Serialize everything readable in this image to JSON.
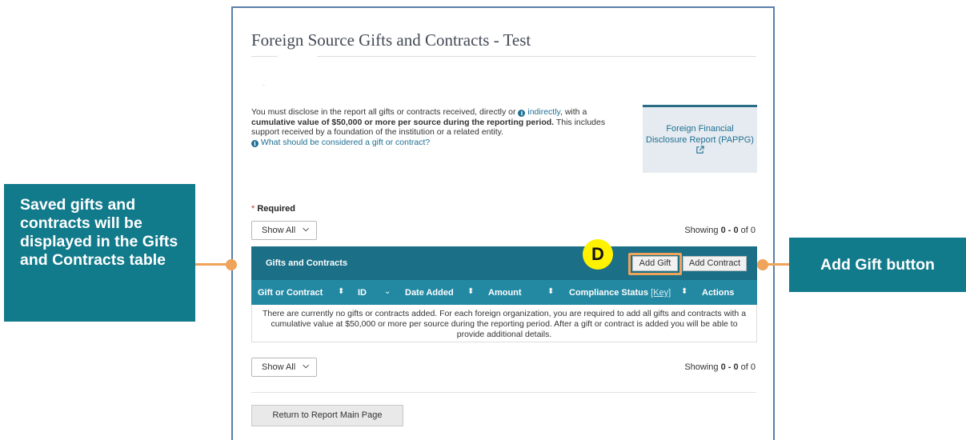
{
  "page": {
    "title": "Foreign Source Gifts and Contracts - Test"
  },
  "disclosure": {
    "text_part1": "You must disclose in the report all gifts or contracts received, directly or ",
    "indirect_link": "indirectly",
    "text_part2": ", with a ",
    "bold_text": "cumulative value of $50,000 or more per source during the reporting period.",
    "text_part3": " This includes support received by a foundation of the institution or a related entity.",
    "help_link": "What should be considered a gift or contract?"
  },
  "pappg_box": {
    "line1": "Foreign Financial",
    "line2": "Disclosure Report (PAPPG)"
  },
  "required_label": "Required",
  "required_star": "*",
  "filter_top": {
    "selected": "Show All"
  },
  "showing_top": {
    "prefix": "Showing ",
    "range": "0 - 0",
    "suffix": " of 0"
  },
  "table": {
    "title": "Gifts and Contracts",
    "add_gift_label": "Add Gift",
    "add_contract_label": "Add Contract",
    "badge": "D",
    "columns": {
      "gift_or_contract": "Gift or Contract",
      "id": "ID",
      "date_added": "Date Added",
      "amount": "Amount",
      "compliance_status": "Compliance Status",
      "key": "[Key]",
      "actions": "Actions"
    },
    "empty_message": "There are currently no gifts or contracts added. For each foreign organization, you are required to add all gifts and contracts with a cumulative value at $50,000 or more per source during the reporting period. After a gift or contract is added you will be able to provide additional details."
  },
  "filter_bottom": {
    "selected": "Show All"
  },
  "showing_bottom": {
    "prefix": "Showing ",
    "range": "0 - 0",
    "suffix": " of 0"
  },
  "return_button": "Return to Report Main Page",
  "callouts": {
    "left": "Saved gifts and contracts will be displayed in the Gifts and Contracts table",
    "right": "Add Gift button"
  },
  "colors": {
    "header_dark": "#1b6f87",
    "header_light": "#2389a3",
    "callout": "#117a8b",
    "highlight": "#f0a35a",
    "badge": "#fff200"
  }
}
